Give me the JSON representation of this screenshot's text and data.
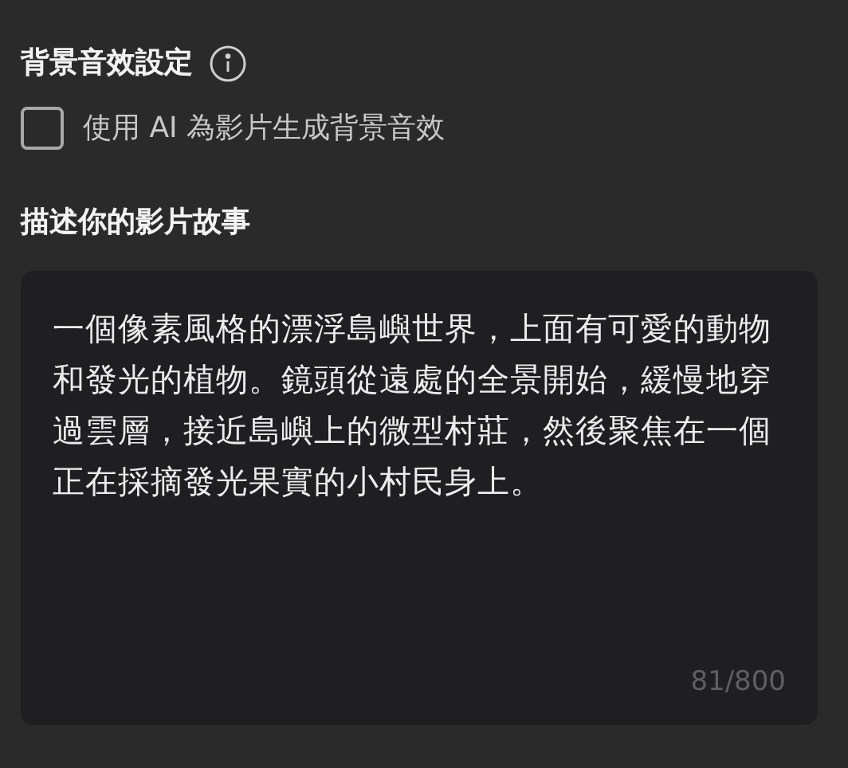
{
  "sound_section": {
    "title": "背景音效設定",
    "checkbox": {
      "label": "使用 AI 為影片生成背景音效",
      "checked": false
    }
  },
  "story_section": {
    "title": "描述你的影片故事",
    "story": {
      "value": "一個像素風格的漂浮島嶼世界，上面有可愛的動物和發光的植物。鏡頭從遠處的全景開始，緩慢地穿過雲層，接近島嶼上的微型村莊，然後聚焦在一個正在採摘發光果實的小村民身上。",
      "counter": "81/800"
    }
  }
}
